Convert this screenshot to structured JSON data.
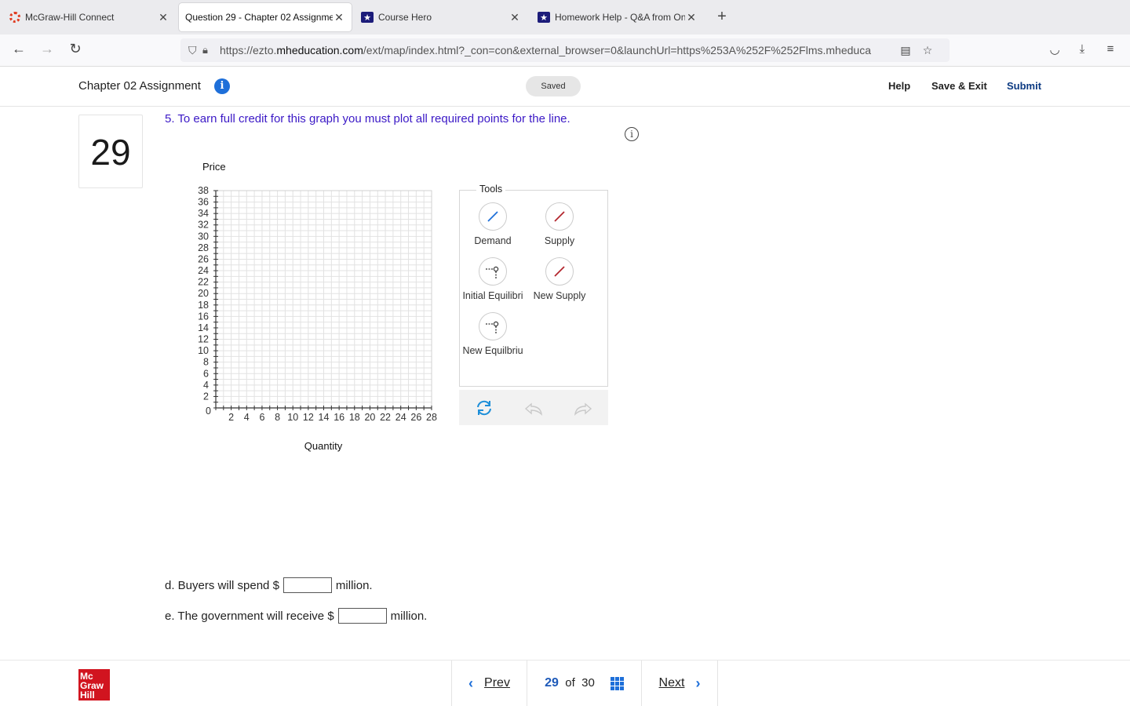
{
  "browser": {
    "tabs": [
      {
        "title": "McGraw-Hill Connect",
        "icon": "connect-ring-icon"
      },
      {
        "title": "Question 29 - Chapter 02 Assignme",
        "icon": "none"
      },
      {
        "title": "Course Hero",
        "icon": "star-icon"
      },
      {
        "title": "Homework Help - Q&A from Onl",
        "icon": "star-icon"
      }
    ],
    "new_tab_label": "+",
    "url_prefix": "https://ezto.",
    "url_domain": "mheducation.com",
    "url_rest": "/ext/map/index.html?_con=con&external_browser=0&launchUrl=https%253A%252F%252Flms.mheduca"
  },
  "header": {
    "title": "Chapter 02 Assignment",
    "saved_label": "Saved",
    "help_label": "Help",
    "save_exit_label": "Save & Exit",
    "submit_label": "Submit"
  },
  "question": {
    "number": "29",
    "instruction": "5. To earn full credit for this graph you must plot all required points for the line."
  },
  "graph": {
    "y_axis_label": "Price",
    "x_axis_label": "Quantity",
    "y_ticks": [
      "38",
      "36",
      "34",
      "32",
      "30",
      "28",
      "26",
      "24",
      "22",
      "20",
      "18",
      "16",
      "14",
      "12",
      "10",
      "8",
      "6",
      "4",
      "2"
    ],
    "origin_label": "0",
    "x_ticks": [
      "2",
      "4",
      "6",
      "8",
      "10",
      "12",
      "14",
      "16",
      "18",
      "20",
      "22",
      "24",
      "26",
      "28"
    ],
    "x_max": 28,
    "y_max": 38
  },
  "tools": {
    "legend": "Tools",
    "items": [
      {
        "label": "Demand",
        "color": "#1e6fd9"
      },
      {
        "label": "Supply",
        "color": "#b3262e"
      },
      {
        "label": "Initial Equilibri",
        "color": "#333333"
      },
      {
        "label": "New Supply",
        "color": "#b3262e"
      },
      {
        "label": "New Equilbriu",
        "color": "#333333"
      }
    ]
  },
  "fill_ins": {
    "d_prefix": "d. Buyers will spend $",
    "d_suffix": "million.",
    "d_value": "",
    "e_prefix": "e. The government will receive $",
    "e_suffix": "million.",
    "e_value": ""
  },
  "footer": {
    "logo_lines": [
      "Mc",
      "Graw",
      "Hill"
    ],
    "prev_label": "Prev",
    "current": "29",
    "of_label": "of",
    "total": "30",
    "next_label": "Next"
  },
  "colors": {
    "accent": "#1e6fd9",
    "instruction": "#3b19c6",
    "brand_red": "#d1141f"
  }
}
